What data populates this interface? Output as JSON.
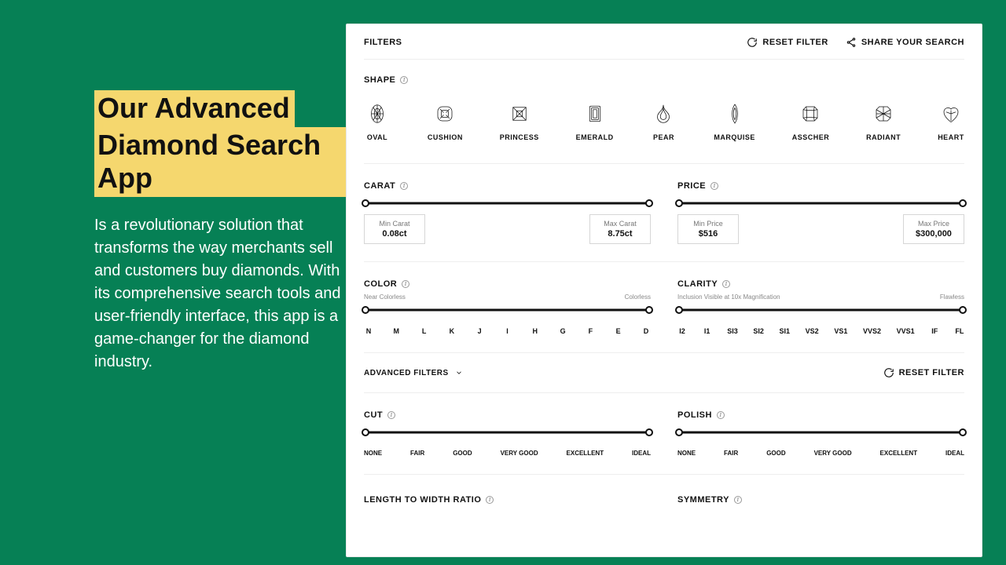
{
  "marketing": {
    "headline_line1": "Our Advanced",
    "headline_line2": "Diamond Search App",
    "body": "Is a revolutionary solution that transforms the way merchants sell and customers buy diamonds. With its comprehensive search tools and user-friendly interface, this app is a game-changer for the diamond industry."
  },
  "topbar": {
    "filters": "FILTERS",
    "reset": "RESET FILTER",
    "share": "SHARE YOUR SEARCH"
  },
  "shape": {
    "title": "SHAPE",
    "items": [
      "OVAL",
      "CUSHION",
      "PRINCESS",
      "EMERALD",
      "PEAR",
      "MARQUISE",
      "ASSCHER",
      "RADIANT",
      "HEART"
    ]
  },
  "carat": {
    "title": "CARAT",
    "min_label": "Min Carat",
    "min_value": "0.08ct",
    "max_label": "Max Carat",
    "max_value": "8.75ct"
  },
  "price": {
    "title": "PRICE",
    "min_label": "Min Price",
    "min_value": "$516",
    "max_label": "Max Price",
    "max_value": "$300,000"
  },
  "color": {
    "title": "COLOR",
    "left_scale": "Near Colorless",
    "right_scale": "Colorless",
    "ticks": [
      "N",
      "M",
      "L",
      "K",
      "J",
      "I",
      "H",
      "G",
      "F",
      "E",
      "D"
    ]
  },
  "clarity": {
    "title": "CLARITY",
    "left_scale": "Inclusion Visible at 10x Magnification",
    "right_scale": "Flawless",
    "ticks": [
      "I2",
      "I1",
      "SI3",
      "SI2",
      "SI1",
      "VS2",
      "VS1",
      "VVS2",
      "VVS1",
      "IF",
      "FL"
    ]
  },
  "advanced": {
    "title": "ADVANCED FILTERS",
    "reset": "RESET FILTER"
  },
  "cut": {
    "title": "CUT",
    "ticks": [
      "NONE",
      "FAIR",
      "GOOD",
      "VERY GOOD",
      "EXCELLENT",
      "IDEAL"
    ]
  },
  "polish": {
    "title": "POLISH",
    "ticks": [
      "NONE",
      "FAIR",
      "GOOD",
      "VERY GOOD",
      "EXCELLENT",
      "IDEAL"
    ]
  },
  "lwr": {
    "title": "LENGTH TO WIDTH RATIO"
  },
  "symmetry": {
    "title": "SYMMETRY"
  }
}
